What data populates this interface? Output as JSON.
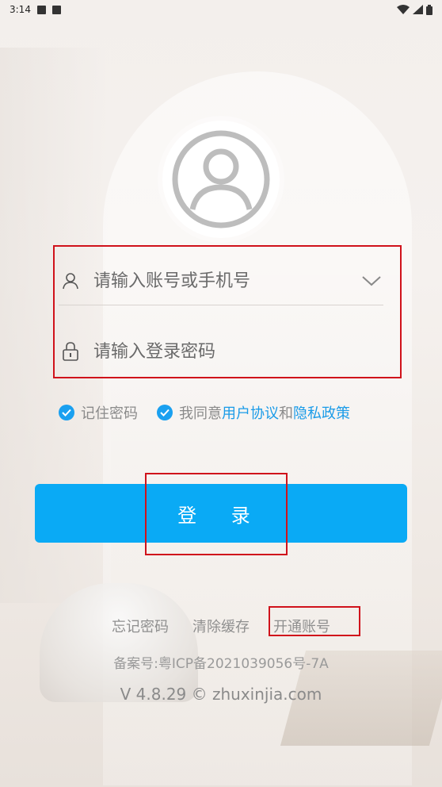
{
  "status_bar": {
    "time": "3:14"
  },
  "login": {
    "account_placeholder": "请输入账号或手机号",
    "password_placeholder": "请输入登录密码",
    "remember_label": "记住密码",
    "agree_prefix": "我同意",
    "user_agreement": "用户协议",
    "and": "和",
    "privacy_policy": "隐私政策",
    "login_button": "登 录"
  },
  "links": {
    "forgot_password": "忘记密码",
    "clear_cache": "清除缓存",
    "open_account": "开通账号"
  },
  "footer": {
    "icp": "备案号:粤ICP备2021039056号-7A",
    "version": "V 4.8.29 © zhuxinjia.com"
  },
  "colors": {
    "accent": "#0aaaf5",
    "link": "#1a9be8",
    "highlight": "#d0121b"
  }
}
